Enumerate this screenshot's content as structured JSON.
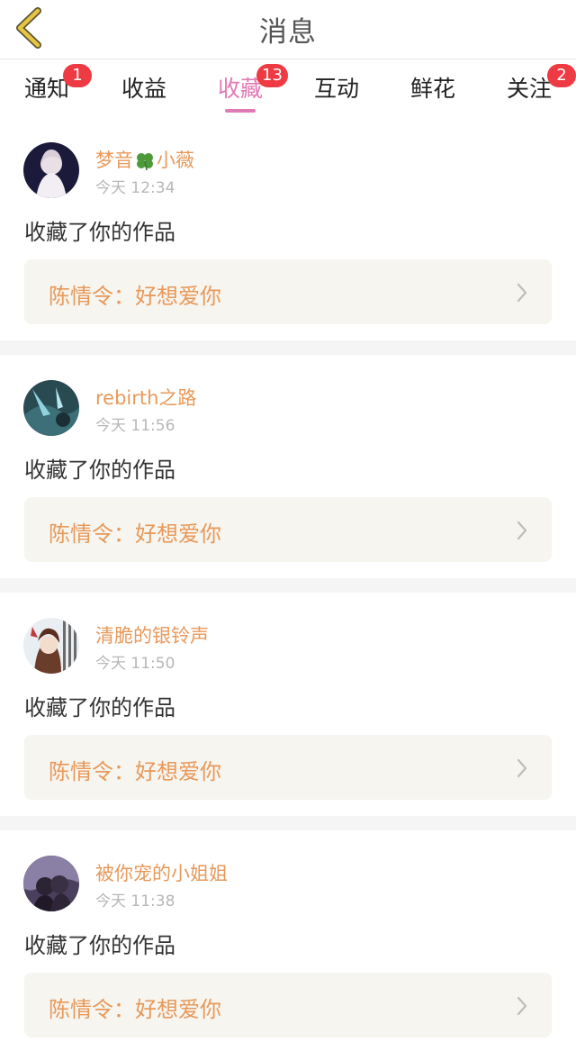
{
  "header": {
    "title": "消息",
    "back_icon": "chevron-left-icon",
    "back_color": "#e8c443"
  },
  "tabs": [
    {
      "label": "通知",
      "badge": "1"
    },
    {
      "label": "收益",
      "badge": ""
    },
    {
      "label": "收藏",
      "badge": "13",
      "active": true
    },
    {
      "label": "互动",
      "badge": ""
    },
    {
      "label": "鲜花",
      "badge": ""
    },
    {
      "label": "关注",
      "badge": "2"
    }
  ],
  "colors": {
    "accent": "#e07ab4",
    "badge": "#ee3a43",
    "username": "#e8995a",
    "work_box": "#f6f5ef"
  },
  "feed": [
    {
      "username_a": "梦音",
      "username_b": "小薇",
      "time": "今天 12:34",
      "action": "收藏了你的作品",
      "work": "陈情令：好想爱你"
    },
    {
      "username_a": "rebirth之路",
      "username_b": "",
      "time": "今天 11:56",
      "action": "收藏了你的作品",
      "work": "陈情令：好想爱你"
    },
    {
      "username_a": "清脆的银铃声",
      "username_b": "",
      "time": "今天 11:50",
      "action": "收藏了你的作品",
      "work": "陈情令：好想爱你"
    },
    {
      "username_a": "被你宠的小姐姐",
      "username_b": "",
      "time": "今天 11:38",
      "action": "收藏了你的作品",
      "work": "陈情令：好想爱你"
    }
  ]
}
